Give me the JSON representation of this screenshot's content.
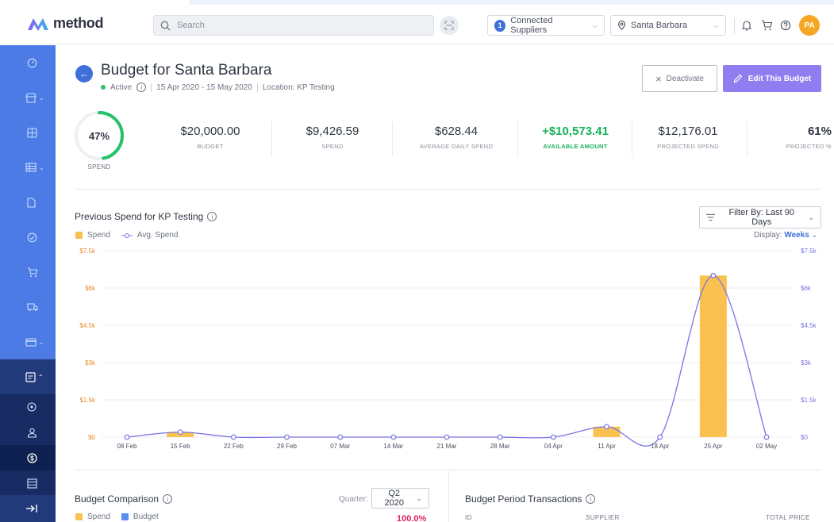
{
  "app": {
    "logo_text": "method"
  },
  "header": {
    "search_placeholder": "Search",
    "suppliers": {
      "count": "1",
      "label": "Connected Suppliers"
    },
    "location": {
      "label": "Santa Barbara"
    },
    "avatar_initials": "PA"
  },
  "sidebar": {
    "items": [
      {
        "icon": "dashboard-icon"
      },
      {
        "icon": "store-icon",
        "expandable": true
      },
      {
        "icon": "catalog-icon"
      },
      {
        "icon": "table-icon",
        "expandable": true
      },
      {
        "icon": "document-icon"
      },
      {
        "icon": "check-circle-icon"
      },
      {
        "icon": "cart-icon"
      },
      {
        "icon": "truck-icon"
      },
      {
        "icon": "card-icon",
        "expandable": true
      },
      {
        "icon": "budget-icon",
        "expandable": true,
        "active": true
      }
    ],
    "subitems": [
      {
        "icon": "location-pin-icon"
      },
      {
        "icon": "users-icon"
      },
      {
        "icon": "dollar-icon",
        "active": true
      },
      {
        "icon": "list-icon"
      }
    ]
  },
  "page": {
    "title": "Budget for Santa Barbara",
    "status": "Active",
    "date_range": "15 Apr 2020 - 15 May 2020",
    "location": "Location: KP Testing",
    "deactivate_label": "Deactivate",
    "edit_label": "Edit This Budget"
  },
  "stats": {
    "gauge": {
      "value": "47%",
      "fraction": 0.47,
      "label": "SPEND"
    },
    "items": [
      {
        "value": "$20,000.00",
        "label": "BUDGET"
      },
      {
        "value": "$9,426.59",
        "label": "SPEND"
      },
      {
        "value": "$628.44",
        "label": "AVERAGE DAILY SPEND"
      },
      {
        "value": "+$10,573.41",
        "label": "AVAILABLE AMOUNT",
        "highlight": true
      },
      {
        "value": "$12,176.01",
        "label": "PROJECTED SPEND"
      },
      {
        "value": "61%",
        "label": "PROJECTED %"
      }
    ]
  },
  "spend_chart": {
    "title": "Previous Spend for KP Testing",
    "filter_label": "Filter By: Last 90 Days",
    "display_label": "Display:",
    "display_value": "Weeks",
    "legend": {
      "spend": "Spend",
      "avg": "Avg. Spend"
    }
  },
  "chart_data": {
    "type": "bar",
    "categories": [
      "08 Feb",
      "15 Feb",
      "22 Feb",
      "29 Feb",
      "07 Mar",
      "14 Mar",
      "21 Mar",
      "28 Mar",
      "04 Apr",
      "11 Apr",
      "18 Apr",
      "25 Apr",
      "02 May"
    ],
    "series": [
      {
        "name": "Spend",
        "type": "bar",
        "values": [
          0,
          200,
          0,
          0,
          0,
          0,
          0,
          0,
          0,
          420,
          0,
          6500,
          0
        ]
      },
      {
        "name": "Avg. Spend",
        "type": "line",
        "values": [
          0,
          200,
          0,
          0,
          0,
          0,
          0,
          0,
          0,
          420,
          0,
          6500,
          0
        ]
      }
    ],
    "yticks": [
      "$0",
      "$1.5k",
      "$3k",
      "$4.5k",
      "$6k",
      "$7.5k"
    ],
    "ylim": [
      0,
      7500
    ],
    "grid": true,
    "colors": {
      "spend": "#f9c14f",
      "avg": "#7a74e0"
    }
  },
  "budget_comparison": {
    "title": "Budget Comparison",
    "quarter_label": "Quarter:",
    "quarter_value": "Q2 2020",
    "legend_spend": "Spend",
    "legend_budget": "Budget",
    "percent": "100.0%"
  },
  "transactions": {
    "title": "Budget Period Transactions",
    "columns": [
      "ID",
      "SUPPLIER",
      "TOTAL PRICE"
    ]
  }
}
